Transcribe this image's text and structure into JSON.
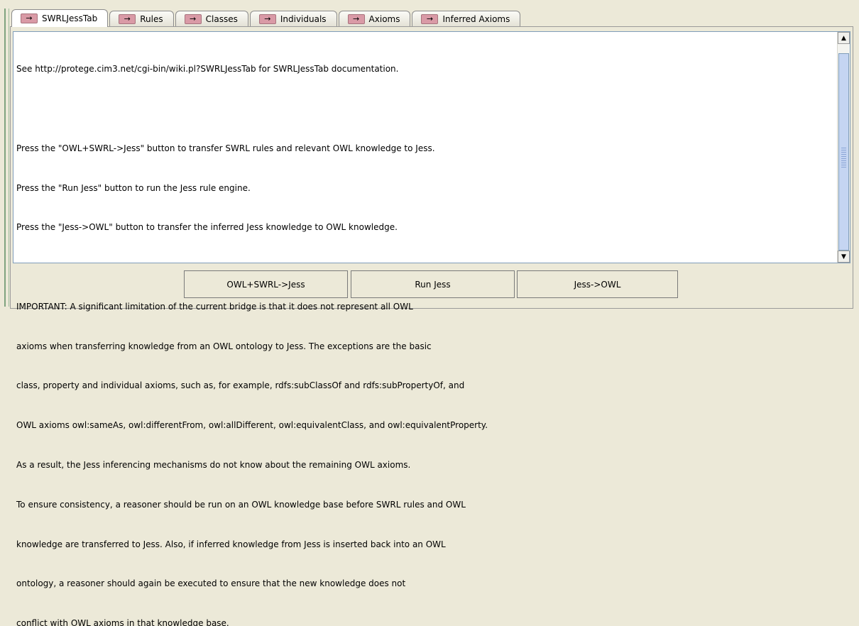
{
  "tabs": [
    {
      "arrow": "→",
      "label": "SWRLJessTab",
      "active": true
    },
    {
      "arrow": "→",
      "label": "Rules"
    },
    {
      "arrow": "→",
      "label": "Classes"
    },
    {
      "arrow": "→",
      "label": "Individuals"
    },
    {
      "arrow": "→",
      "label": "Axioms"
    },
    {
      "arrow": "→",
      "label": "Inferred Axioms"
    }
  ],
  "document": {
    "lines": [
      "See http://protege.cim3.net/cgi-bin/wiki.pl?SWRLJessTab for SWRLJessTab documentation.",
      "",
      "Press the \"OWL+SWRL->Jess\" button to transfer SWRL rules and relevant OWL knowledge to Jess.",
      "Press the \"Run Jess\" button to run the Jess rule engine.",
      "Press the \"Jess->OWL\" button to transfer the inferred Jess knowledge to OWL knowledge.",
      "",
      "IMPORTANT: A significant limitation of the current bridge is that it does not represent all OWL",
      "axioms when transferring knowledge from an OWL ontology to Jess. The exceptions are the basic",
      "class, property and individual axioms, such as, for example, rdfs:subClassOf and rdfs:subPropertyOf, and",
      "OWL axioms owl:sameAs, owl:differentFrom, owl:allDifferent, owl:equivalentClass, and owl:equivalentProperty.",
      "As a result, the Jess inferencing mechanisms do not know about the remaining OWL axioms.",
      "To ensure consistency, a reasoner should be run on an OWL knowledge base before SWRL rules and OWL",
      "knowledge are transferred to Jess. Also, if inferred knowledge from Jess is inserted back into an OWL",
      "ontology, a reasoner should again be executed to ensure that the new knowledge does not",
      "conflict with OWL axioms in that knowledge base."
    ]
  },
  "scrollbar": {
    "up_glyph": "▲",
    "down_glyph": "▼"
  },
  "buttons": {
    "owl_swrl_to_jess": "OWL+SWRL->Jess",
    "run_jess": "Run Jess",
    "jess_to_owl": "Jess->OWL"
  },
  "colors": {
    "tab_arrow": "#d99aa6",
    "scroll_thumb": "#c5d5f2",
    "window_bg": "#ece9d8"
  }
}
